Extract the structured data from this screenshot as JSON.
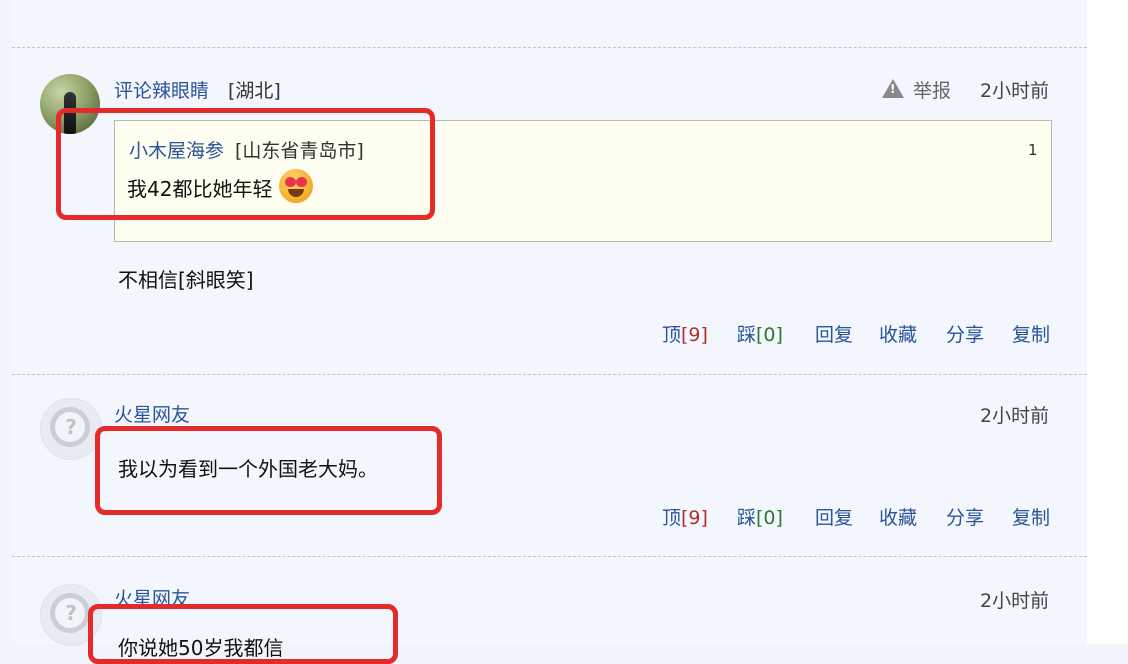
{
  "comments": [
    {
      "username": "评论辣眼睛",
      "region": "[湖北]",
      "report_label": "举报",
      "time": "2小时前",
      "quote": {
        "username": "小木屋海参",
        "region": "[山东省青岛市]",
        "floor": "1",
        "text": "我42都比她年轻"
      },
      "text": "不相信[斜眼笑]",
      "actions": {
        "up_label": "顶",
        "up_count": "[9]",
        "down_label": "踩",
        "down_count": "[0]",
        "reply": "回复",
        "fav": "收藏",
        "share": "分享",
        "copy": "复制"
      }
    },
    {
      "username": "火星网友",
      "time": "2小时前",
      "text": "我以为看到一个外国老大妈。",
      "actions": {
        "up_label": "顶",
        "up_count": "[9]",
        "down_label": "踩",
        "down_count": "[0]",
        "reply": "回复",
        "fav": "收藏",
        "share": "分享",
        "copy": "复制"
      }
    },
    {
      "username": "火星网友",
      "time": "2小时前",
      "text": "你说她50岁我都信"
    }
  ],
  "colors": {
    "highlight": "#e52a2a",
    "link": "#2a5599"
  }
}
